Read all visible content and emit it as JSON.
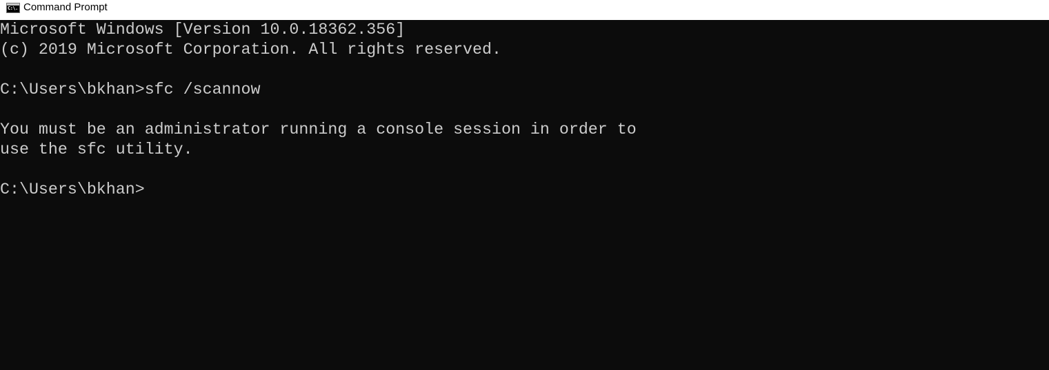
{
  "window": {
    "title": "Command Prompt",
    "icon_name": "cmd-icon",
    "icon_text": "C:\\."
  },
  "console": {
    "lines": [
      "Microsoft Windows [Version 10.0.18362.356]",
      "(c) 2019 Microsoft Corporation. All rights reserved.",
      "",
      "C:\\Users\\bkhan>sfc /scannow",
      "",
      "You must be an administrator running a console session in order to",
      "use the sfc utility.",
      "",
      "C:\\Users\\bkhan>"
    ]
  },
  "colors": {
    "background": "#0c0c0c",
    "foreground": "#cccccc",
    "titlebar": "#ffffff"
  }
}
